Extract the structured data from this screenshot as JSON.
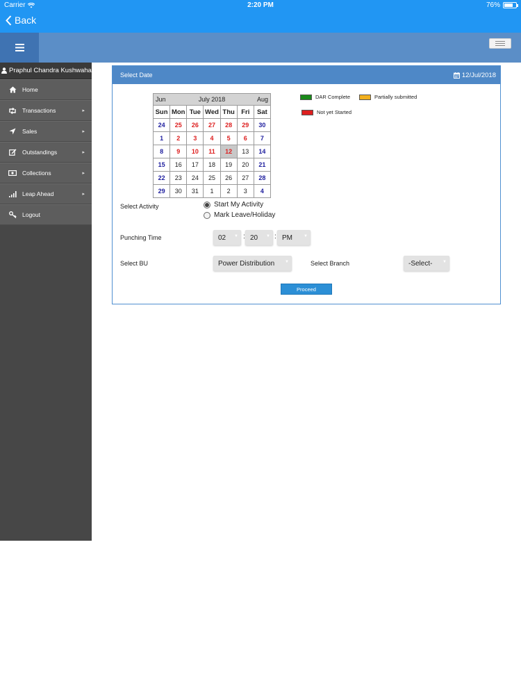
{
  "status_bar": {
    "carrier": "Carrier",
    "time": "2:20 PM",
    "battery": "76%",
    "battery_level": 0.76
  },
  "nav": {
    "back_label": "Back"
  },
  "sidebar": {
    "user_name": "Praphul Chandra Kushwaha",
    "items": [
      {
        "label": "Home",
        "icon": "home-icon",
        "has_arrow": false
      },
      {
        "label": "Transactions",
        "icon": "retweet-icon",
        "has_arrow": true
      },
      {
        "label": "Sales",
        "icon": "location-arrow-icon",
        "has_arrow": true
      },
      {
        "label": "Outstandings",
        "icon": "edit-icon",
        "has_arrow": true
      },
      {
        "label": "Collections",
        "icon": "money-icon",
        "has_arrow": true
      },
      {
        "label": "Leap Ahead",
        "icon": "signal-icon",
        "has_arrow": true
      },
      {
        "label": "Logout",
        "icon": "key-icon",
        "has_arrow": false
      }
    ]
  },
  "card": {
    "title": "Select Date",
    "selected_date": "12/Jul/2018"
  },
  "calendar": {
    "prev_label": "Jun",
    "title": "July 2018",
    "next_label": "Aug",
    "weekdays": [
      "Sun",
      "Mon",
      "Tue",
      "Wed",
      "Thu",
      "Fri",
      "Sat"
    ],
    "weeks": [
      [
        {
          "d": "24",
          "s": "blue"
        },
        {
          "d": "25",
          "s": "red"
        },
        {
          "d": "26",
          "s": "red"
        },
        {
          "d": "27",
          "s": "red"
        },
        {
          "d": "28",
          "s": "red"
        },
        {
          "d": "29",
          "s": "red"
        },
        {
          "d": "30",
          "s": "blue"
        }
      ],
      [
        {
          "d": "1",
          "s": "blue"
        },
        {
          "d": "2",
          "s": "red"
        },
        {
          "d": "3",
          "s": "red"
        },
        {
          "d": "4",
          "s": "red"
        },
        {
          "d": "5",
          "s": "red"
        },
        {
          "d": "6",
          "s": "red"
        },
        {
          "d": "7",
          "s": "blue"
        }
      ],
      [
        {
          "d": "8",
          "s": "blue"
        },
        {
          "d": "9",
          "s": "red"
        },
        {
          "d": "10",
          "s": "red"
        },
        {
          "d": "11",
          "s": "red"
        },
        {
          "d": "12",
          "s": "sel"
        },
        {
          "d": "13",
          "s": "black"
        },
        {
          "d": "14",
          "s": "blue"
        }
      ],
      [
        {
          "d": "15",
          "s": "blue"
        },
        {
          "d": "16",
          "s": "black"
        },
        {
          "d": "17",
          "s": "black"
        },
        {
          "d": "18",
          "s": "black"
        },
        {
          "d": "19",
          "s": "black"
        },
        {
          "d": "20",
          "s": "black"
        },
        {
          "d": "21",
          "s": "blue"
        }
      ],
      [
        {
          "d": "22",
          "s": "blue"
        },
        {
          "d": "23",
          "s": "black"
        },
        {
          "d": "24",
          "s": "black"
        },
        {
          "d": "25",
          "s": "black"
        },
        {
          "d": "26",
          "s": "black"
        },
        {
          "d": "27",
          "s": "black"
        },
        {
          "d": "28",
          "s": "blue"
        }
      ],
      [
        {
          "d": "29",
          "s": "blue"
        },
        {
          "d": "30",
          "s": "black"
        },
        {
          "d": "31",
          "s": "black"
        },
        {
          "d": "1",
          "s": "black"
        },
        {
          "d": "2",
          "s": "black"
        },
        {
          "d": "3",
          "s": "black"
        },
        {
          "d": "4",
          "s": "blue"
        }
      ]
    ]
  },
  "legend": {
    "dar_complete": "DAR Complete",
    "partially_submitted": "Partially submitted",
    "not_yet_started": "Not yet Started"
  },
  "colors": {
    "blue_day": "#1e1e9e",
    "red_day": "#dd1f1f",
    "dar_complete": "#1a8a1a",
    "partially_submitted": "#f2b01e",
    "not_yet_started": "#dd1f1f",
    "accent": "#2196f3"
  },
  "form": {
    "select_activity_label": "Select Activity",
    "activity_options": [
      {
        "label": "Start My Activity",
        "checked": true
      },
      {
        "label": "Mark Leave/Holiday",
        "checked": false
      }
    ],
    "punching_time_label": "Punching Time",
    "hour": "02",
    "minute": "20",
    "ampm": "PM",
    "time_separator": ":",
    "select_bu_label": "Select BU",
    "bu_value": "Power Distribution",
    "select_branch_label": "Select Branch",
    "branch_value": "-Select-",
    "proceed_label": "Proceed"
  }
}
